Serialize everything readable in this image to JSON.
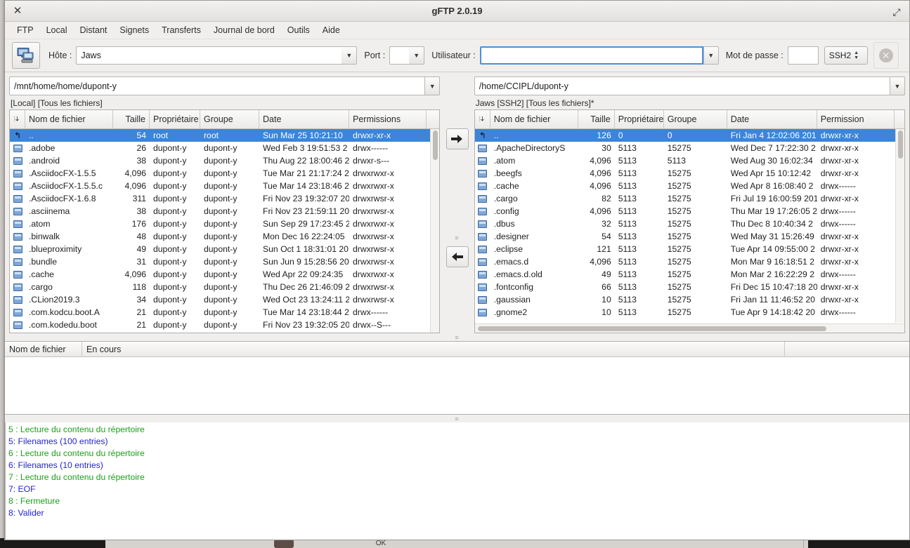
{
  "window": {
    "title": "gFTP 2.0.19",
    "close_icon": "✕",
    "maximize_icon": "⤢"
  },
  "menubar": {
    "items": [
      {
        "label": "FTP",
        "name": "menu-ftp"
      },
      {
        "label": "Local",
        "name": "menu-local"
      },
      {
        "label": "Distant",
        "name": "menu-distant"
      },
      {
        "label": "Signets",
        "name": "menu-signets"
      },
      {
        "label": "Transferts",
        "name": "menu-transferts"
      },
      {
        "label": "Journal de bord",
        "name": "menu-journal-de-bord"
      },
      {
        "label": "Outils",
        "name": "menu-outils"
      },
      {
        "label": "Aide",
        "name": "menu-aide"
      }
    ]
  },
  "toolbar": {
    "host_label": "Hôte :",
    "host_value": "Jaws",
    "port_label": "Port :",
    "port_value": "",
    "user_label": "Utilisateur :",
    "user_value": "",
    "password_label": "Mot de passe :",
    "password_value": "",
    "protocol_value": "SSH2",
    "stop_icon": "✕",
    "dropdown_icon": "▼"
  },
  "left_pane": {
    "path": "/mnt/home/home/dupont-y",
    "status": "[Local] [Tous les fichiers]",
    "columns": [
      "Nom de fichier",
      "Taille",
      "Propriétaire",
      "Groupe",
      "Date",
      "Permissions"
    ],
    "rows": [
      {
        "icon": "updir",
        "name": "..",
        "size": "54",
        "owner": "root",
        "group": "root",
        "date": "Sun Mar 25 10:21:10 ",
        "perms": "drwxr-xr-x",
        "selected": true
      },
      {
        "icon": "folder",
        "name": ".adobe",
        "size": "26",
        "owner": "dupont-y",
        "group": "dupont-y",
        "date": "Wed Feb  3 19:51:53 2",
        "perms": "drwx------",
        "selected": false
      },
      {
        "icon": "folder",
        "name": ".android",
        "size": "38",
        "owner": "dupont-y",
        "group": "dupont-y",
        "date": "Thu Aug 22 18:00:46 2",
        "perms": "drwxr-s---",
        "selected": false
      },
      {
        "icon": "folder",
        "name": ".AsciidocFX-1.5.5",
        "size": "4,096",
        "owner": "dupont-y",
        "group": "dupont-y",
        "date": "Tue Mar 21 21:17:24 2",
        "perms": "drwxrwxr-x",
        "selected": false
      },
      {
        "icon": "folder",
        "name": ".AsciidocFX-1.5.5.c",
        "size": "4,096",
        "owner": "dupont-y",
        "group": "dupont-y",
        "date": "Tue Mar 14 23:18:46 2",
        "perms": "drwxrwxr-x",
        "selected": false
      },
      {
        "icon": "folder",
        "name": ".AsciidocFX-1.6.8",
        "size": "311",
        "owner": "dupont-y",
        "group": "dupont-y",
        "date": "Fri Nov 23 19:32:07 20",
        "perms": "drwxrwsr-x",
        "selected": false
      },
      {
        "icon": "folder",
        "name": ".asciinema",
        "size": "38",
        "owner": "dupont-y",
        "group": "dupont-y",
        "date": "Fri Nov 23 21:59:11 20",
        "perms": "drwxrwsr-x",
        "selected": false
      },
      {
        "icon": "folder",
        "name": ".atom",
        "size": "176",
        "owner": "dupont-y",
        "group": "dupont-y",
        "date": "Sun Sep 29 17:23:45 2",
        "perms": "drwxrwxr-x",
        "selected": false
      },
      {
        "icon": "folder",
        "name": ".binwalk",
        "size": "48",
        "owner": "dupont-y",
        "group": "dupont-y",
        "date": "Mon Dec 16 22:24:05 ",
        "perms": "drwxrwsr-x",
        "selected": false
      },
      {
        "icon": "folder",
        "name": ".blueproximity",
        "size": "49",
        "owner": "dupont-y",
        "group": "dupont-y",
        "date": "Sun Oct  1 18:31:01 20",
        "perms": "drwxrwsr-x",
        "selected": false
      },
      {
        "icon": "folder",
        "name": ".bundle",
        "size": "31",
        "owner": "dupont-y",
        "group": "dupont-y",
        "date": "Sun Jun  9 15:28:56 20",
        "perms": "drwxrwsr-x",
        "selected": false
      },
      {
        "icon": "folder",
        "name": ".cache",
        "size": "4,096",
        "owner": "dupont-y",
        "group": "dupont-y",
        "date": "Wed Apr 22 09:24:35 ",
        "perms": "drwxrwxr-x",
        "selected": false
      },
      {
        "icon": "folder",
        "name": ".cargo",
        "size": "118",
        "owner": "dupont-y",
        "group": "dupont-y",
        "date": "Thu Dec 26 21:46:09 2",
        "perms": "drwxrwsr-x",
        "selected": false
      },
      {
        "icon": "folder",
        "name": ".CLion2019.3",
        "size": "34",
        "owner": "dupont-y",
        "group": "dupont-y",
        "date": "Wed Oct 23 13:24:11 2",
        "perms": "drwxrwsr-x",
        "selected": false
      },
      {
        "icon": "folder",
        "name": ".com.kodcu.boot.A",
        "size": "21",
        "owner": "dupont-y",
        "group": "dupont-y",
        "date": "Tue Mar 14 23:18:44 2",
        "perms": "drwx------",
        "selected": false
      },
      {
        "icon": "folder",
        "name": ".com.kodedu.boot",
        "size": "21",
        "owner": "dupont-y",
        "group": "dupont-y",
        "date": "Fri Nov 23 19:32:05 20",
        "perms": "drwx--S---",
        "selected": false
      }
    ]
  },
  "right_pane": {
    "path": "/home/CCIPL/dupont-y",
    "status": "Jaws [SSH2] [Tous les fichiers]*",
    "columns": [
      "Nom de fichier",
      "Taille",
      "Propriétaire",
      "Groupe",
      "Date",
      "Permission"
    ],
    "rows": [
      {
        "icon": "updir",
        "name": "..",
        "size": "126",
        "owner": "0",
        "group": "0",
        "date": "Fri Jan  4 12:02:06 201",
        "perms": "drwxr-xr-x",
        "selected": true
      },
      {
        "icon": "folder",
        "name": ".ApacheDirectoryS",
        "size": "30",
        "owner": "5113",
        "group": "15275",
        "date": "Wed Dec  7 17:22:30 2",
        "perms": "drwxr-xr-x",
        "selected": false
      },
      {
        "icon": "folder",
        "name": ".atom",
        "size": "4,096",
        "owner": "5113",
        "group": "5113",
        "date": "Wed Aug 30 16:02:34 ",
        "perms": "drwxr-xr-x",
        "selected": false
      },
      {
        "icon": "folder",
        "name": ".beegfs",
        "size": "4,096",
        "owner": "5113",
        "group": "15275",
        "date": "Wed Apr 15 10:12:42 ",
        "perms": "drwxr-xr-x",
        "selected": false
      },
      {
        "icon": "folder",
        "name": ".cache",
        "size": "4,096",
        "owner": "5113",
        "group": "15275",
        "date": "Wed Apr  8 16:08:40 2",
        "perms": "drwx------",
        "selected": false
      },
      {
        "icon": "folder",
        "name": ".cargo",
        "size": "82",
        "owner": "5113",
        "group": "15275",
        "date": "Fri Jul 19 16:00:59 201",
        "perms": "drwxr-xr-x",
        "selected": false
      },
      {
        "icon": "folder",
        "name": ".config",
        "size": "4,096",
        "owner": "5113",
        "group": "15275",
        "date": "Thu Mar 19 17:26:05 2",
        "perms": "drwx------",
        "selected": false
      },
      {
        "icon": "folder",
        "name": ".dbus",
        "size": "32",
        "owner": "5113",
        "group": "15275",
        "date": "Thu Dec  8 10:40:34 2",
        "perms": "drwx------",
        "selected": false
      },
      {
        "icon": "folder",
        "name": ".designer",
        "size": "54",
        "owner": "5113",
        "group": "15275",
        "date": "Wed May 31 15:26:49 ",
        "perms": "drwxr-xr-x",
        "selected": false
      },
      {
        "icon": "folder",
        "name": ".eclipse",
        "size": "121",
        "owner": "5113",
        "group": "15275",
        "date": "Tue Apr 14 09:55:00 2",
        "perms": "drwxr-xr-x",
        "selected": false
      },
      {
        "icon": "folder",
        "name": ".emacs.d",
        "size": "4,096",
        "owner": "5113",
        "group": "15275",
        "date": "Mon Mar  9 16:18:51 2",
        "perms": "drwxr-xr-x",
        "selected": false
      },
      {
        "icon": "folder",
        "name": ".emacs.d.old",
        "size": "49",
        "owner": "5113",
        "group": "15275",
        "date": "Mon Mar  2 16:22:29 2",
        "perms": "drwx------",
        "selected": false
      },
      {
        "icon": "folder",
        "name": ".fontconfig",
        "size": "66",
        "owner": "5113",
        "group": "15275",
        "date": "Fri Dec 15 10:47:18 20",
        "perms": "drwxr-xr-x",
        "selected": false
      },
      {
        "icon": "folder",
        "name": ".gaussian",
        "size": "10",
        "owner": "5113",
        "group": "15275",
        "date": "Fri Jan 11 11:46:52 20",
        "perms": "drwxr-xr-x",
        "selected": false
      },
      {
        "icon": "folder",
        "name": ".gnome2",
        "size": "10",
        "owner": "5113",
        "group": "15275",
        "date": "Tue Apr  9 14:18:42 20",
        "perms": "drwx------",
        "selected": false
      }
    ]
  },
  "transfer_buttons": {
    "upload_icon": "➜",
    "download_icon": "➜"
  },
  "transfer_list": {
    "columns": [
      "Nom de fichier",
      "En cours"
    ],
    "rows": []
  },
  "log": {
    "lines": [
      {
        "text": "5 : Lecture du contenu du répertoire",
        "color": "#1ba01b"
      },
      {
        "text": "5: Filenames (100 entries)",
        "color": "#2222dd"
      },
      {
        "text": "6 : Lecture du contenu du répertoire",
        "color": "#1ba01b"
      },
      {
        "text": "6: Filenames (10 entries)",
        "color": "#2222dd"
      },
      {
        "text": "7 : Lecture du contenu du répertoire",
        "color": "#1ba01b"
      },
      {
        "text": "7: EOF",
        "color": "#2222dd"
      },
      {
        "text": "8 : Fermeture",
        "color": "#1ba01b"
      },
      {
        "text": "8: Valider",
        "color": "#2222dd"
      }
    ]
  },
  "background": {
    "ok_label": "OK"
  },
  "colors": {
    "selection": "#3c85d8",
    "window_bg": "#f0efee",
    "log_green": "#1ba01b",
    "log_blue": "#2222dd"
  }
}
